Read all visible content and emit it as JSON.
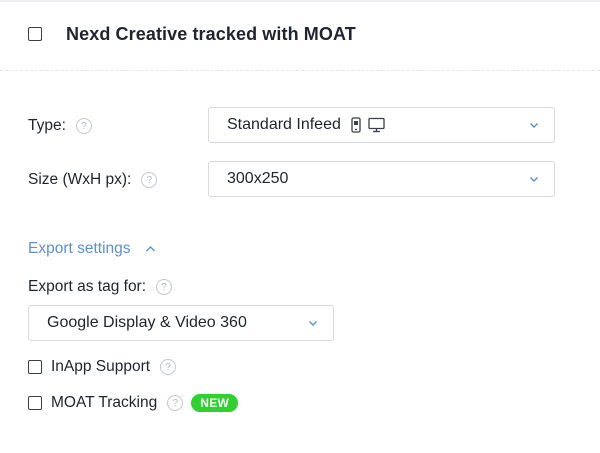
{
  "header": {
    "title": "Nexd Creative tracked with MOAT",
    "checked": false
  },
  "type_field": {
    "label": "Type:",
    "value": "Standard Infeed",
    "icons": [
      "mobile-device-icon",
      "desktop-monitor-icon"
    ]
  },
  "size_field": {
    "label": "Size (WxH px):",
    "value": "300x250"
  },
  "export_settings": {
    "toggle_label": "Export settings",
    "expanded": true,
    "tag_label": "Export as tag for:",
    "tag_value": "Google Display & Video 360"
  },
  "options": {
    "inapp": {
      "label": "InApp Support",
      "checked": false
    },
    "moat": {
      "label": "MOAT Tracking",
      "checked": false,
      "badge": "NEW"
    }
  },
  "colors": {
    "accent_link": "#5b8fd8",
    "badge_green": "#2fd12f",
    "border": "#d8dce2"
  }
}
